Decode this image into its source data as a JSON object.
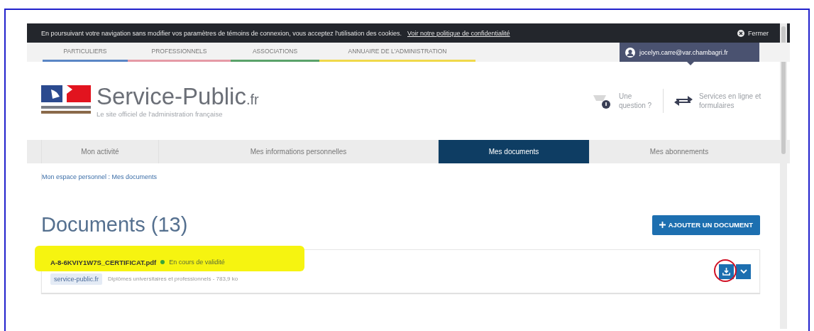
{
  "cookie_bar": {
    "text": "En poursuivant votre navigation sans modifier vos paramètres de témoins de connexion, vous acceptez l'utilisation des cookies.",
    "link": "Voir notre politique de confidentialité",
    "close": "Fermer"
  },
  "categories": [
    {
      "label": "PARTICULIERS",
      "color": "#5a86c5"
    },
    {
      "label": "PROFESSIONNELS",
      "color": "#e59aa6"
    },
    {
      "label": "ASSOCIATIONS",
      "color": "#5aa26a"
    },
    {
      "label": "ANNUAIRE DE L'ADMINISTRATION",
      "color": "#f0d84a"
    }
  ],
  "user": {
    "email": "jocelyn.carre@var.chambagri.fr"
  },
  "site": {
    "name": "Service-Public",
    "suffix": ".fr",
    "tagline": "Le site officiel de l'administration française"
  },
  "header_links": [
    {
      "kind": "question",
      "label": "Une question ?"
    },
    {
      "kind": "services",
      "label": "Services en ligne et formulaires"
    }
  ],
  "tabs": [
    {
      "label": "Mon activité",
      "selected": false
    },
    {
      "label": "Mes informations personnelles",
      "selected": false
    },
    {
      "label": "Mes documents",
      "selected": true
    },
    {
      "label": "Mes abonnements",
      "selected": false
    }
  ],
  "breadcrumb": "Mon espace personnel : Mes documents",
  "documents": {
    "title": "Documents (13)",
    "add_button": "AJOUTER UN DOCUMENT",
    "items": [
      {
        "name": "A-8-6KVIY1W7S_CERTIFICAT.pdf",
        "status": "En cours de validité",
        "color": "#3aa53a",
        "source": "service-public.fr",
        "description": "Diplômes universitaires et professionnels - 783,9 ko",
        "highlighted": true,
        "download_circled": true
      }
    ]
  }
}
